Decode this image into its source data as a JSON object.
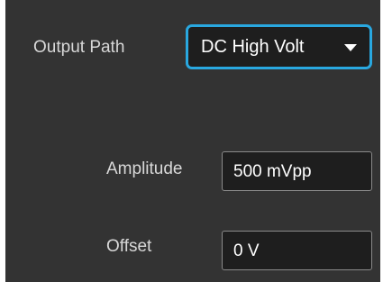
{
  "output_path": {
    "label": "Output Path",
    "selected": "DC High Volt",
    "focus_color": "#29a8e0"
  },
  "amplitude": {
    "label": "Amplitude",
    "value": "500 mVpp"
  },
  "offset": {
    "label": "Offset",
    "value": "0 V"
  },
  "icons": {
    "dropdown_arrow": "chevron-down-icon"
  },
  "colors": {
    "panel_background": "#333333",
    "field_background": "#1e1e1e",
    "label_text": "#d8d8d8",
    "value_text": "#ffffff"
  }
}
